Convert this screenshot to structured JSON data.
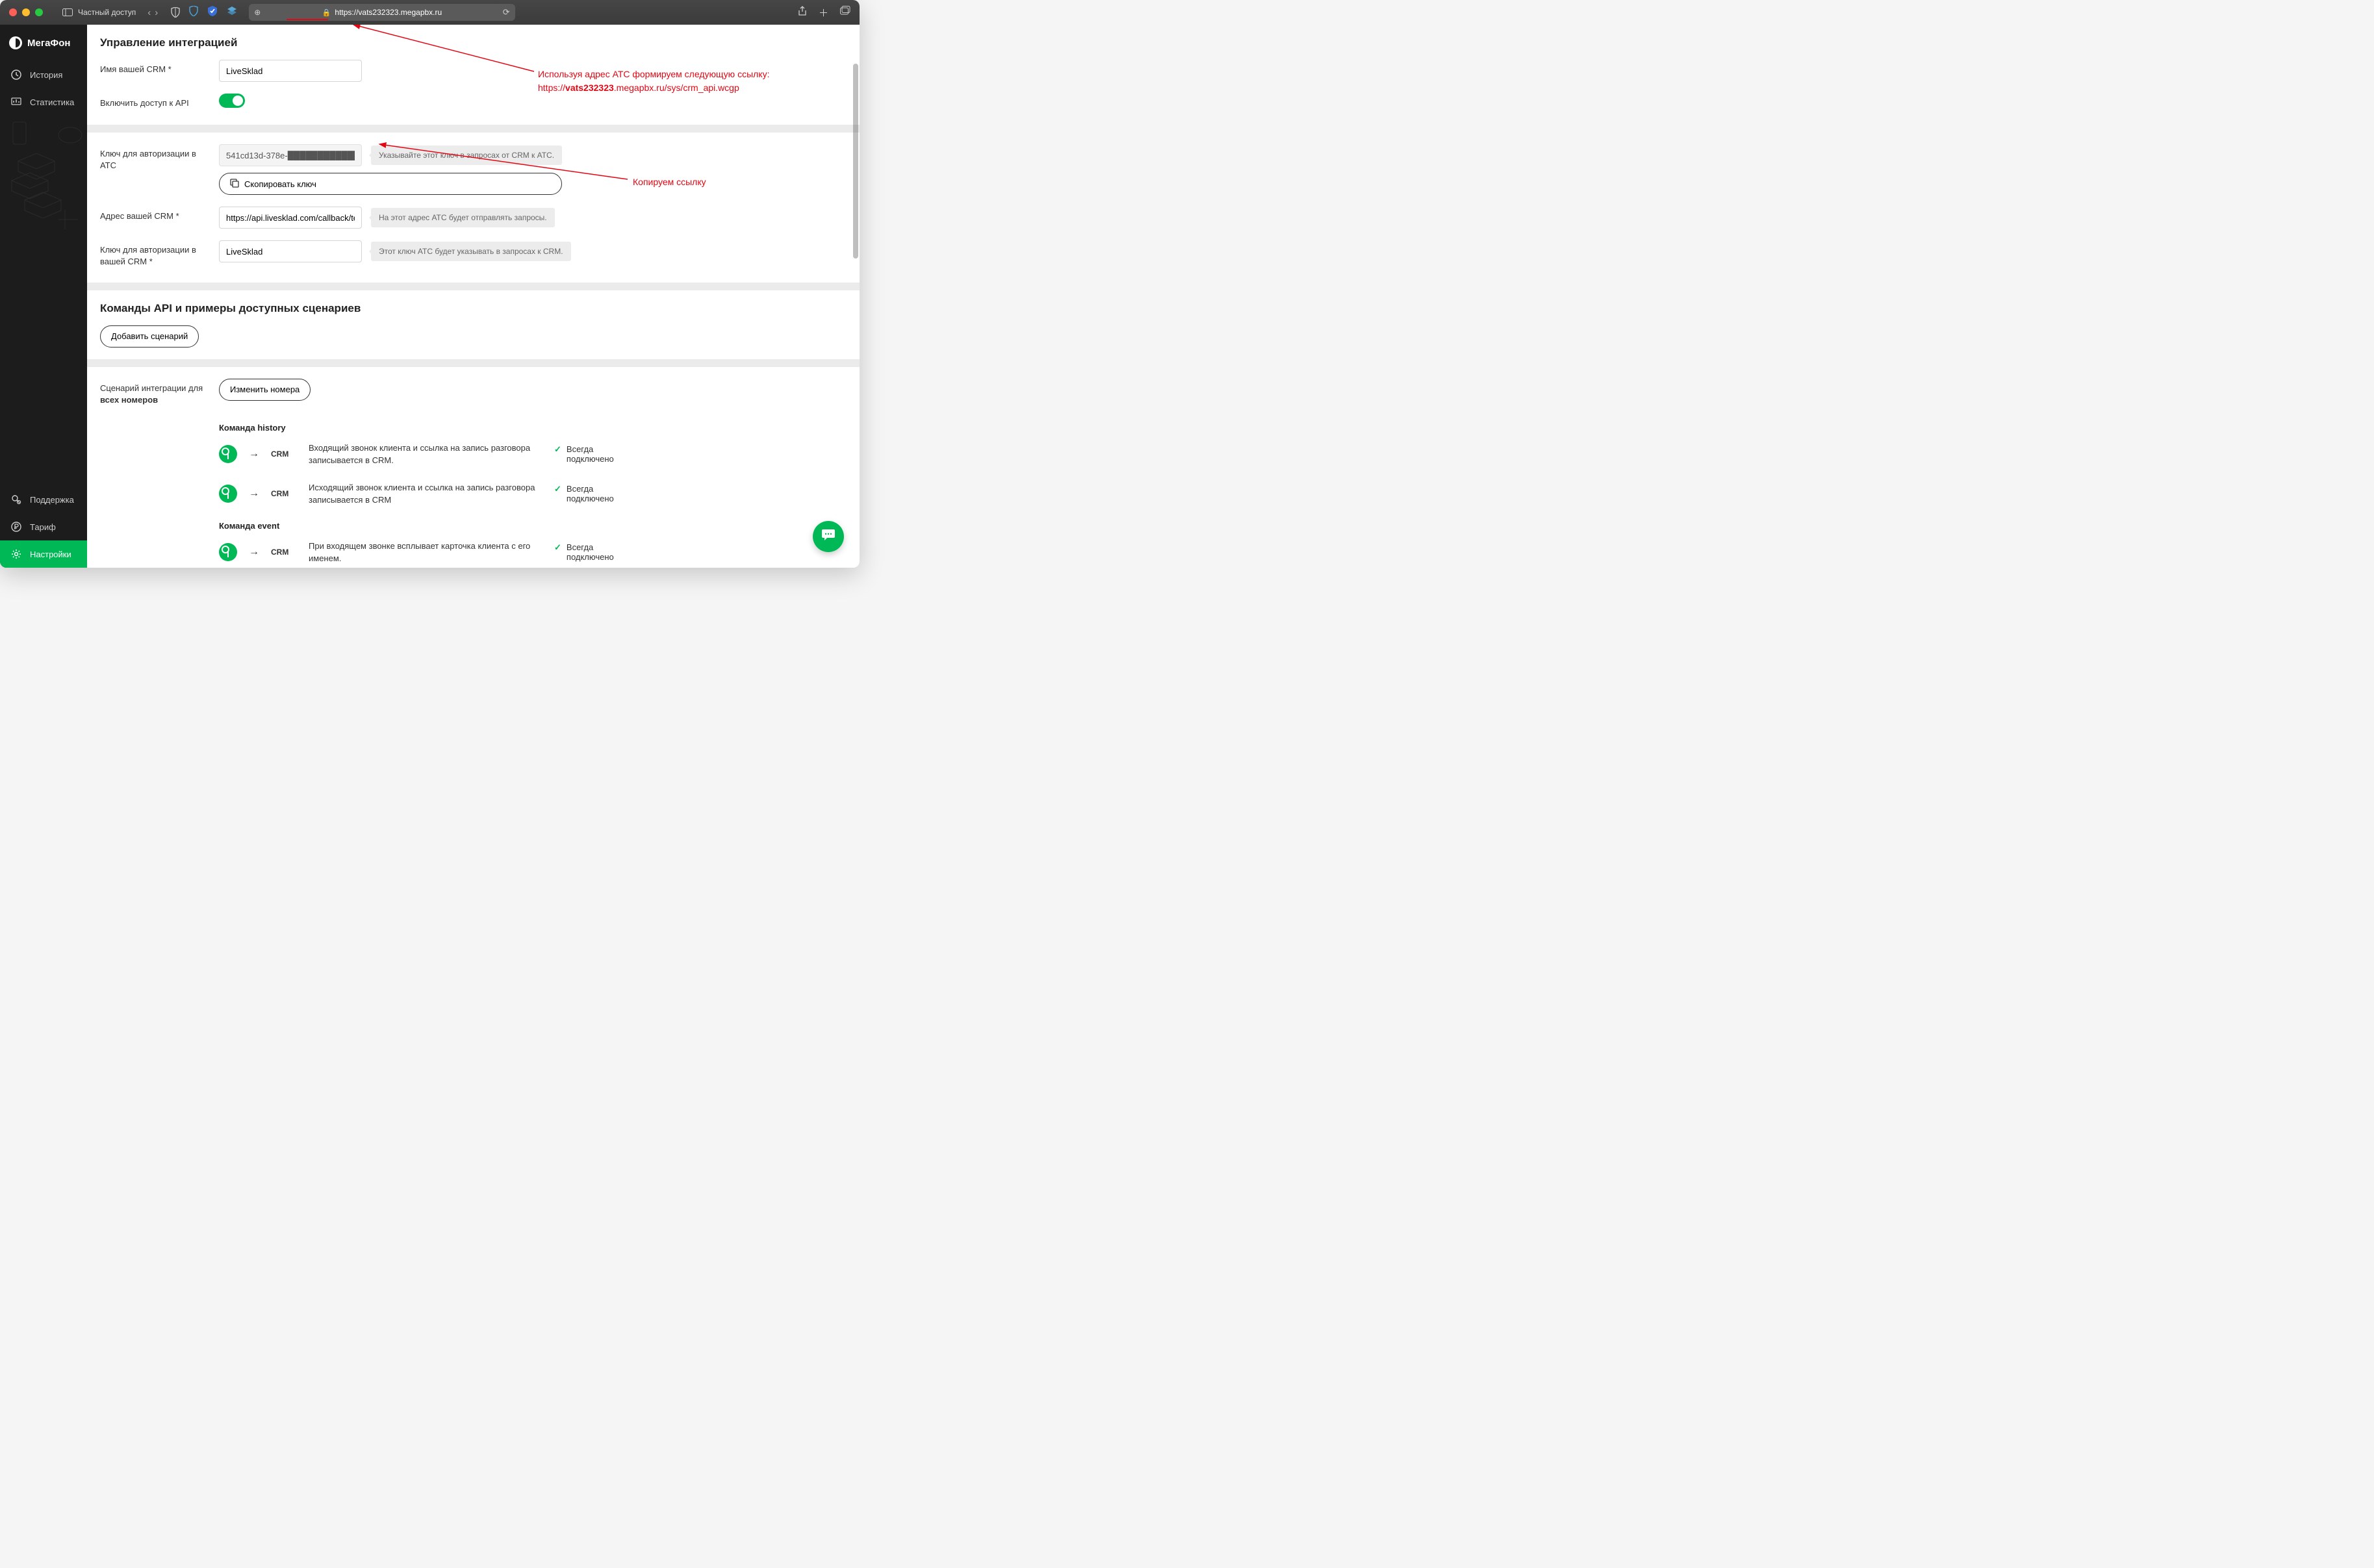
{
  "titlebar": {
    "private_label": "Частный доступ",
    "url": "https://vats232323.megapbx.ru"
  },
  "sidebar": {
    "brand": "МегаФон",
    "items": [
      {
        "icon": "history",
        "label": "История"
      },
      {
        "icon": "stats",
        "label": "Статистика"
      },
      {
        "icon": "support",
        "label": "Поддержка"
      },
      {
        "icon": "tariff",
        "label": "Тариф"
      },
      {
        "icon": "settings",
        "label": "Настройки",
        "active": true
      }
    ]
  },
  "integration": {
    "title": "Управление интеграцией",
    "crm_name_label": "Имя вашей CRM *",
    "crm_name_value": "LiveSklad",
    "api_access_label": "Включить доступ к API",
    "api_access_on": true,
    "ats_key_label": "Ключ для авторизации в АТС",
    "ats_key_value": "541cd13d-378e-████████████████",
    "ats_key_hint": "Указывайте этот ключ в запросах от CRM к АТС.",
    "copy_key_btn": "Скопировать ключ",
    "crm_addr_label": "Адрес вашей CRM *",
    "crm_addr_value": "https://api.livesklad.com/callback/telephony",
    "crm_addr_hint": "На этот адрес АТС будет отправлять запросы.",
    "crm_key_label": "Ключ для авторизации в вашей CRM *",
    "crm_key_value": "LiveSklad",
    "crm_key_hint": "Этот ключ АТС будет указывать в запросах к CRM."
  },
  "commands": {
    "title": "Команды API и примеры доступных сценариев",
    "add_btn": "Добавить сценарий",
    "scenario_label_1": "Сценарий интеграции для",
    "scenario_label_2": "всех номеров",
    "change_btn": "Изменить номера",
    "sections": [
      {
        "title": "Команда history",
        "rows": [
          {
            "crm": "CRM",
            "desc": "Входящий звонок клиента и ссылка на запись разговора записывается в CRM.",
            "status": "Всегда подключено"
          },
          {
            "crm": "CRM",
            "desc": "Исходящий звонок клиента и ссылка на запись разговора записывается в CRM",
            "status": "Всегда подключено"
          }
        ]
      },
      {
        "title": "Команда event",
        "rows": [
          {
            "crm": "CRM",
            "desc": "При входящем звонке всплывает карточка клиента с его именем.",
            "status": "Всегда подключено"
          }
        ]
      }
    ]
  },
  "annotations": {
    "line1a": "Используя адрес АТС формируем следующую ссылку:",
    "line1b_pre": "https://",
    "line1b_bold": "vats232323",
    "line1b_post": ".megapbx.ru/sys/crm_api.wcgp",
    "line2": "Копируем ссылку"
  }
}
